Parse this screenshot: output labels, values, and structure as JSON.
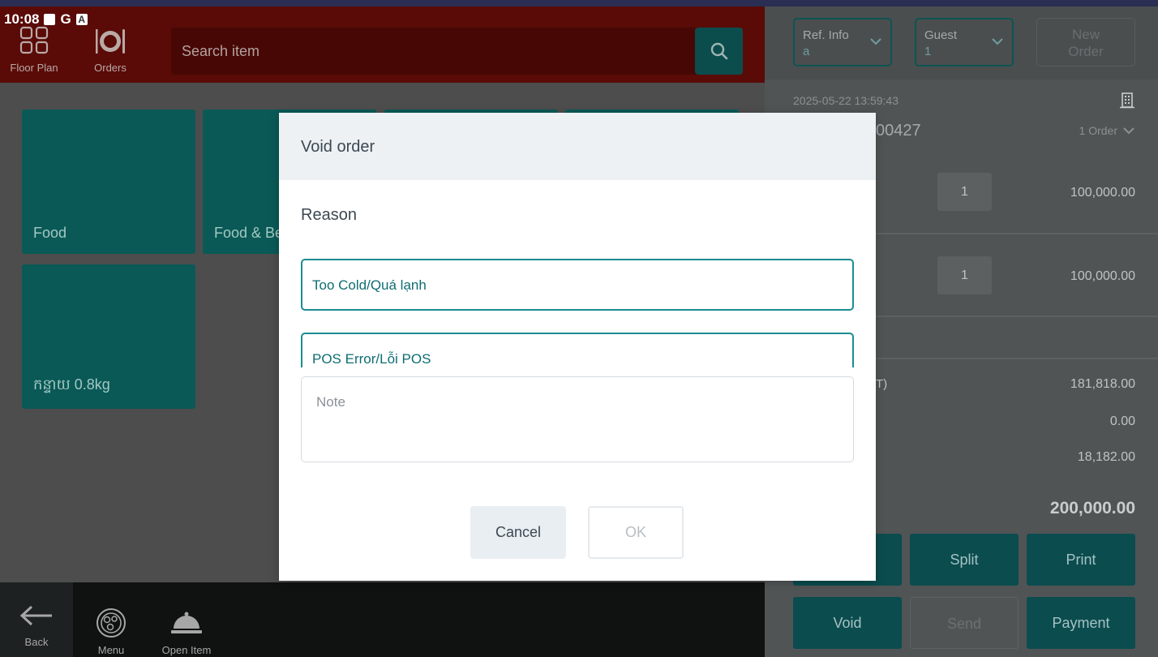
{
  "status_bar": {
    "time": "10:08",
    "g_label": "G",
    "a_label": "A"
  },
  "header": {
    "nav": [
      {
        "label": "Floor Plan",
        "icon": "floor-plan-icon"
      },
      {
        "label": "Orders",
        "icon": "orders-icon"
      }
    ],
    "search": {
      "placeholder": "Search item",
      "icon": "search-icon"
    }
  },
  "categories": [
    {
      "label": "Food"
    },
    {
      "label": "Food & Be"
    },
    {
      "label": ""
    },
    {
      "label": ""
    },
    {
      "label": "កន្ទាយ 0.8kg"
    }
  ],
  "footer": {
    "back_label": "Back",
    "items": [
      {
        "label": "Menu",
        "icon": "menu-plate-icon"
      },
      {
        "label": "Open Item",
        "icon": "cloche-icon"
      }
    ]
  },
  "order_panel": {
    "ref_info": {
      "label": "Ref. Info",
      "value": "a"
    },
    "guest": {
      "label": "Guest",
      "value": "1"
    },
    "new_order_label": "New Order",
    "datetime": "2025-05-22 13:59:43",
    "order_number_partial": "00427",
    "order_count": "1 Order",
    "items": [
      {
        "qty": "1",
        "amount": "100,000.00"
      },
      {
        "qty": "1",
        "amount": "100,000.00"
      }
    ],
    "summary": {
      "label_fragment": "T)",
      "subtotal": "181,818.00",
      "discount": "0.00",
      "tax": "18,182.00",
      "total": "200,000.00"
    },
    "buttons": {
      "split": "Split",
      "print": "Print",
      "void": "Void",
      "send": "Send",
      "payment": "Payment"
    }
  },
  "modal": {
    "title": "Void order",
    "reason_label": "Reason",
    "reasons": [
      "Too Cold/Quá lạnh",
      "POS Error/Lỗi POS"
    ],
    "note_placeholder": "Note",
    "cancel_label": "Cancel",
    "ok_label": "OK"
  },
  "colors": {
    "header_bg": "#5a0b07",
    "tile_bg": "#0a5956",
    "accent_teal": "#1a8c91",
    "modal_head_bg": "#edf1f4"
  }
}
